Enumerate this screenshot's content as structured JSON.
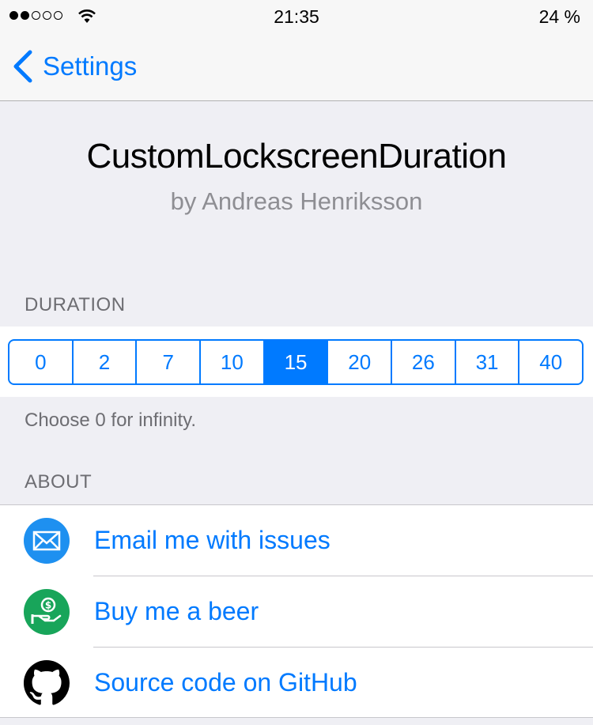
{
  "status_bar": {
    "time": "21:35",
    "battery": "24 %",
    "signal_bars_filled": 2,
    "signal_bars_total": 5
  },
  "nav": {
    "back_label": "Settings"
  },
  "header": {
    "title": "CustomLockscreenDuration",
    "author": "by Andreas Henriksson"
  },
  "duration": {
    "section_title": "DURATION",
    "options": [
      "0",
      "2",
      "7",
      "10",
      "15",
      "20",
      "26",
      "31",
      "40"
    ],
    "selected": "15",
    "footer": "Choose 0 for infinity."
  },
  "about": {
    "section_title": "ABOUT",
    "items": [
      {
        "label": "Email me with issues",
        "icon": "mail-icon",
        "color": "#1e90f0"
      },
      {
        "label": "Buy me a beer",
        "icon": "money-hand-icon",
        "color": "#18a55a"
      },
      {
        "label": "Source code on GitHub",
        "icon": "github-icon",
        "color": "#000000"
      }
    ]
  },
  "colors": {
    "accent": "#007aff",
    "background": "#efeff4",
    "secondary_text": "#6d6d72"
  }
}
